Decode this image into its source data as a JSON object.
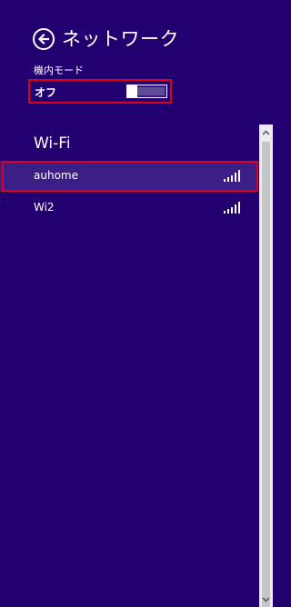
{
  "header": {
    "title": "ネットワーク"
  },
  "airplane_mode": {
    "label": "機内モード",
    "state_text": "オフ",
    "enabled": false
  },
  "wifi": {
    "section_title": "Wi-Fi",
    "networks": [
      {
        "name": "auhome",
        "selected": true,
        "signal_bars": 5
      },
      {
        "name": "Wi2",
        "selected": false,
        "signal_bars": 5
      }
    ]
  },
  "colors": {
    "background": "#220070",
    "selection": "#3b1e86",
    "highlight_border": "#e0001a",
    "text": "#ffffff",
    "scrollbar": "#ececec"
  },
  "icons": {
    "back": "back-arrow-circle-icon",
    "signal": "wifi-signal-icon",
    "scroll_up": "chevron-up-icon",
    "scroll_down": "chevron-down-icon"
  }
}
